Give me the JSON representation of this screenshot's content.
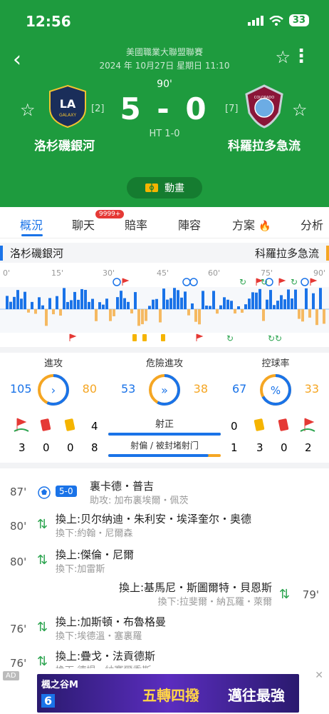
{
  "status": {
    "time": "12:56",
    "battery": "33"
  },
  "header": {
    "league": "美國職業大聯盟聯賽",
    "date": "2024 年 10月27日 星期日 11:10",
    "minute": "90'",
    "score": "5 - 0",
    "halftime": "HT 1-0",
    "home": {
      "name": "洛杉磯銀河",
      "rank": "[2]",
      "logo_text": "LA",
      "logo_sub": "GALAXY"
    },
    "away": {
      "name": "科羅拉多急流",
      "rank": "[7]",
      "logo_text": "COLORADO"
    },
    "animation_label": "動畫"
  },
  "tabs": [
    {
      "label": "概況",
      "active": true
    },
    {
      "label": "聊天",
      "badge": "9999+"
    },
    {
      "label": "賠率"
    },
    {
      "label": "陣容"
    },
    {
      "label": "方案"
    },
    {
      "label": "分析"
    }
  ],
  "teams_bar": {
    "home": "洛杉磯銀河",
    "away": "科羅拉多急流"
  },
  "timeline": {
    "ticks": [
      "0'",
      "15'",
      "30'",
      "45'",
      "60'",
      "75'",
      "90'"
    ]
  },
  "stats": [
    {
      "title": "進攻",
      "home": "105",
      "away": "80",
      "home_share": 0.57,
      "icon": "›"
    },
    {
      "title": "危險進攻",
      "home": "53",
      "away": "38",
      "home_share": 0.58,
      "icon": "»"
    },
    {
      "title": "控球率",
      "home": "67",
      "away": "33",
      "home_share": 0.67,
      "icon": "%"
    }
  ],
  "counts": {
    "shots_on_label": "射正",
    "shots_off_label": "射偏 / 被封堵射门",
    "home_shots_on": "4",
    "away_shots_on": "0",
    "home_shots_off": "8",
    "away_shots_off": "1",
    "home_corners": "3",
    "home_red": "0",
    "home_yellow": "0",
    "away_yellow": "3",
    "away_red": "0",
    "away_corners": "2",
    "shots_on_home_share": 1.0,
    "shots_off_home_share": 0.89
  },
  "events": [
    {
      "minute": "87'",
      "type": "goal",
      "score_badge": "5-0",
      "main": "裏卡德・普吉",
      "sub": "助攻: 加布裏埃爾・佩茨",
      "side": "home"
    },
    {
      "minute": "80'",
      "type": "sub",
      "main": "換上:贝尔纳迪・朱利安・埃泽奎尔・奥德",
      "sub": "換下:約翰・尼爾森",
      "side": "home"
    },
    {
      "minute": "80'",
      "type": "sub",
      "main": "換上:傑倫・尼爾",
      "sub": "換下:加雷斯",
      "side": "home"
    },
    {
      "minute": "79'",
      "type": "sub",
      "main": "換上:基馬尼・斯圖爾特・貝恩斯",
      "sub": "換下:拉斐爾・納瓦羅・萊爾",
      "side": "away"
    },
    {
      "minute": "76'",
      "type": "sub",
      "main": "換上:加斯頓・布魯格曼",
      "sub": "換下:埃德溫・塞裏羅",
      "side": "home"
    },
    {
      "minute": "76'",
      "type": "sub",
      "main": "換上:疊戈・法貢德斯",
      "sub": "換下:德提・納賽爾秀斯",
      "side": "home"
    }
  ],
  "ad": {
    "label": "AD",
    "brand": "楓之谷M",
    "slogan": "五轉四撥",
    "cta": "邁往最強",
    "number": "6"
  }
}
